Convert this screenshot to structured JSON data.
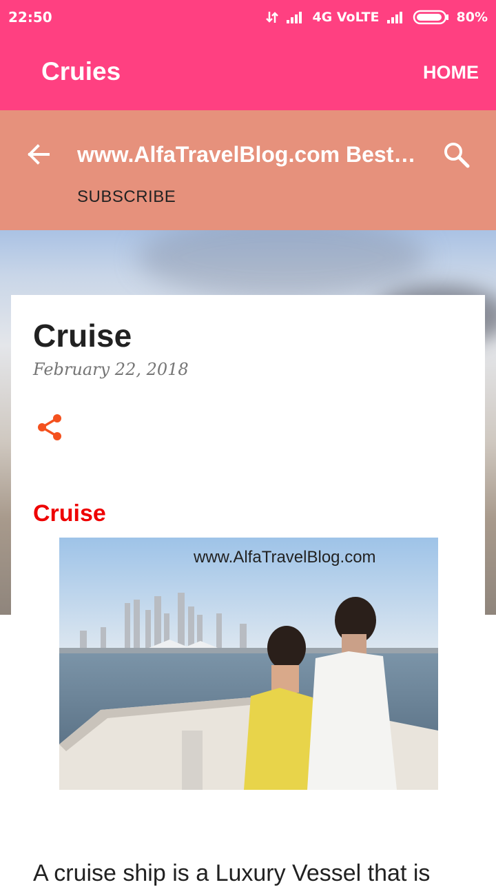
{
  "status_bar": {
    "time": "22:50",
    "network": "4G VoLTE",
    "battery": "80%"
  },
  "app_bar": {
    "title": "Cruies",
    "home_label": "HOME",
    "color": "#ff4081"
  },
  "blog_header": {
    "title": "www.AlfaTravelBlog.com Best Tr...",
    "subscribe_label": "SUBSCRIBE",
    "color": "#e6917c",
    "icons": [
      "back-arrow-icon",
      "search-icon"
    ]
  },
  "post": {
    "title": "Cruise",
    "date": "February 22, 2018",
    "share_icon": "share-icon",
    "share_color": "#f4511e",
    "section_heading": "Cruise",
    "heading_color": "#ee0000",
    "image_watermark": "www.AlfaTravelBlog.com",
    "body_excerpt": "A cruise ship is a Luxury Vessel that is"
  }
}
